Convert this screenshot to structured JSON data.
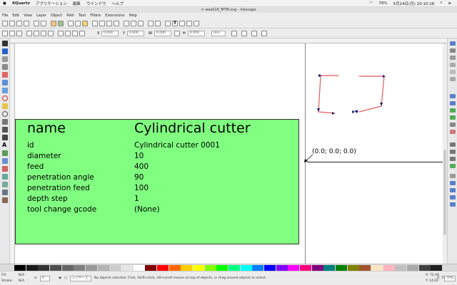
{
  "mac": {
    "app": "XQuartz",
    "menus": [
      "アプリケーション",
      "編集",
      "ウインドウ",
      "ヘルプ"
    ],
    "battery": "79%",
    "clock": "5月14日(月) 20:10:18"
  },
  "window": {
    "title": "week16_MTM.svg - Inkscape"
  },
  "menubar": [
    "File",
    "Edit",
    "View",
    "Layer",
    "Object",
    "Path",
    "Text",
    "Filters",
    "Extensions",
    "Help"
  ],
  "controls": {
    "x_label": "X",
    "x_value": "0.000",
    "y_label": "Y",
    "y_value": "0.000",
    "w_label": "W",
    "w_value": "0.000",
    "h_label": "H",
    "h_value": "0.000",
    "unit": "mm"
  },
  "card": {
    "name_label": "name",
    "name_value": "Cylindrical cutter",
    "rows": [
      {
        "key": "id",
        "value": "Cylindrical cutter 0001"
      },
      {
        "key": "diameter",
        "value": "10"
      },
      {
        "key": "feed",
        "value": "400"
      },
      {
        "key": "penetration angle",
        "value": "90"
      },
      {
        "key": "penetration feed",
        "value": "100"
      },
      {
        "key": "depth step",
        "value": "1"
      },
      {
        "key": "tool change gcode",
        "value": "(None)"
      }
    ]
  },
  "origin_label": "(0.0; 0.0; 0.0)",
  "palette_colors": [
    "#000000",
    "#1a1a1a",
    "#333333",
    "#4d4d4d",
    "#666666",
    "#808080",
    "#999999",
    "#b3b3b3",
    "#cccccc",
    "#e6e6e6",
    "#ffffff",
    "#800000",
    "#ff0000",
    "#ff6600",
    "#ffcc00",
    "#ffff00",
    "#80ff00",
    "#00ff00",
    "#00ff80",
    "#00ffff",
    "#0080ff",
    "#0000ff",
    "#8000ff",
    "#ff00ff",
    "#ff0080",
    "#800080",
    "#008080",
    "#008000",
    "#808000",
    "#a0522d",
    "#ffe4c4",
    "#ffb6c1",
    "#c0c0c0",
    "#a9a9a9",
    "#404040",
    "#202020"
  ],
  "status": {
    "fill_label": "Fill:",
    "fill_value": "N/A",
    "stroke_label": "Stroke:",
    "stroke_value": "N/A",
    "opacity": "0",
    "layer": "レイヤー 1",
    "message": "No objects selected. Click, Shift+click, Alt+scroll mouse on top of objects, or drag around objects to select.",
    "x": "X: 72.49",
    "y": "Y: 14.02",
    "zoom": "Z: 70%",
    "zoom_field": "70%"
  }
}
